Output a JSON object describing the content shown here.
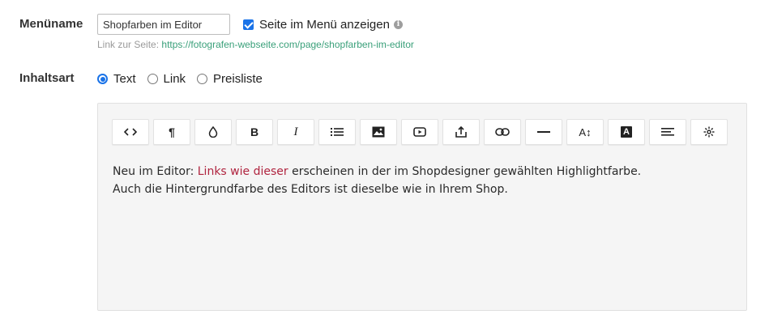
{
  "menu": {
    "label": "Menüname",
    "input_value": "Shopfarben im Editor",
    "show_in_menu_label": "Seite im Menü anzeigen",
    "show_in_menu_checked": true,
    "link_prefix": "Link zur Seite:",
    "link_url": "https://fotografen-webseite.com/page/shopfarben-im-editor"
  },
  "content_type": {
    "label": "Inhaltsart",
    "options": [
      {
        "label": "Text",
        "selected": true
      },
      {
        "label": "Link",
        "selected": false
      },
      {
        "label": "Preisliste",
        "selected": false
      }
    ]
  },
  "editor": {
    "toolbar": [
      {
        "icon": "code-icon"
      },
      {
        "icon": "paragraph-icon",
        "glyph": "¶"
      },
      {
        "icon": "color-drop-icon"
      },
      {
        "icon": "bold-icon",
        "glyph": "B"
      },
      {
        "icon": "italic-icon",
        "glyph": "I"
      },
      {
        "icon": "list-icon"
      },
      {
        "icon": "image-icon"
      },
      {
        "icon": "video-icon"
      },
      {
        "icon": "upload-icon"
      },
      {
        "icon": "link-icon"
      },
      {
        "icon": "horizontal-rule-icon"
      },
      {
        "icon": "font-size-icon",
        "glyph": "A↕"
      },
      {
        "icon": "text-color-icon",
        "glyph": "A"
      },
      {
        "icon": "align-icon"
      },
      {
        "icon": "settings-icon"
      }
    ],
    "line1_before": "Neu im Editor: ",
    "line1_highlight": "Links wie dieser",
    "line1_after": " erscheinen in der im Shopdesigner gewählten Highlightfarbe.",
    "line2": "Auch die Hintergrundfarbe des Editors ist dieselbe wie in Ihrem Shop.",
    "highlight_color": "#b0243f",
    "background_color": "#f5f5f5"
  },
  "colors": {
    "accent": "#1a73e8",
    "link": "#3aa07a"
  }
}
